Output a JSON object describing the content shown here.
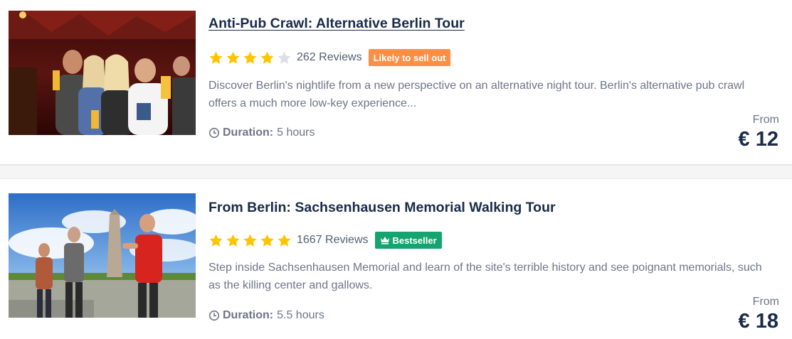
{
  "tours": [
    {
      "title": "Anti-Pub Crawl: Alternative Berlin Tour",
      "rating": 4,
      "rating_max": 5,
      "reviews": "262 Reviews",
      "badge": "Likely to sell out",
      "badge_color": "#fd8f45",
      "description": "Discover Berlin's nightlife from a new perspective on an alternative night tour. Berlin's alternative pub crawl offers a much more low-key experience...",
      "duration_label": "Duration:",
      "duration_value": "5 hours",
      "from_label": "From",
      "price": "€ 12",
      "image_icon": "group-photo-pub"
    },
    {
      "title": "From Berlin: Sachsenhausen Memorial Walking Tour",
      "rating": 5,
      "rating_max": 5,
      "reviews": "1667 Reviews",
      "badge": "Bestseller",
      "badge_color": "#15a36f",
      "badge_icon": "crown-icon",
      "description": "Step inside Sachsenhausen Memorial and learn of the site's terrible history and see poignant memorials, such as the killing center and gallows.",
      "duration_label": "Duration:",
      "duration_value": "5.5 hours",
      "from_label": "From",
      "price": "€ 18",
      "image_icon": "memorial-tour-photo"
    }
  ],
  "colors": {
    "star_filled": "#ffc400",
    "star_empty": "#dcdfe4",
    "title": "#1a2b49",
    "text_muted": "#6e7588"
  }
}
